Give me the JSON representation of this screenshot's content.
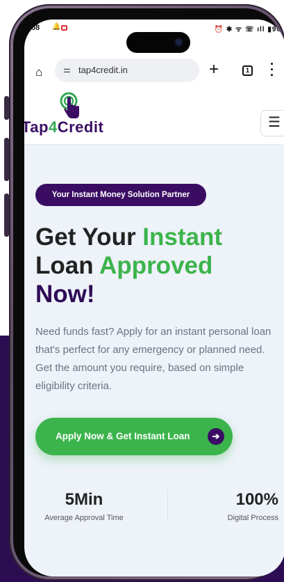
{
  "status_bar": {
    "time": "08",
    "icons_right": "⏰ ✱ ᯤ ☏ ıll ▮96"
  },
  "browser": {
    "url": "tap4credit.in",
    "tab_count": "1"
  },
  "site": {
    "logo_part1": "Tap",
    "logo_part2": "4",
    "logo_part3": "Credit",
    "menu_icon": "☰"
  },
  "hero": {
    "badge": "Your Instant Money Solution Partner",
    "headline_line1_a": "Get Your ",
    "headline_line1_b": "Instant",
    "headline_line2_a": "Loan ",
    "headline_line2_b": "Approved",
    "headline_line3": "Now!",
    "description": "Need funds fast? Apply for an instant personal loan that's perfect for any emergency or planned need. Get the amount you require, based on simple eligibility criteria.",
    "cta_label": "Apply Now & Get Instant Loan"
  },
  "stats": [
    {
      "value": "5Min",
      "caption": "Average Approval Time"
    },
    {
      "value": "100%",
      "caption": "Digital Process"
    }
  ],
  "colors": {
    "brand_purple": "#3a0d63",
    "brand_green": "#3cb44c"
  }
}
